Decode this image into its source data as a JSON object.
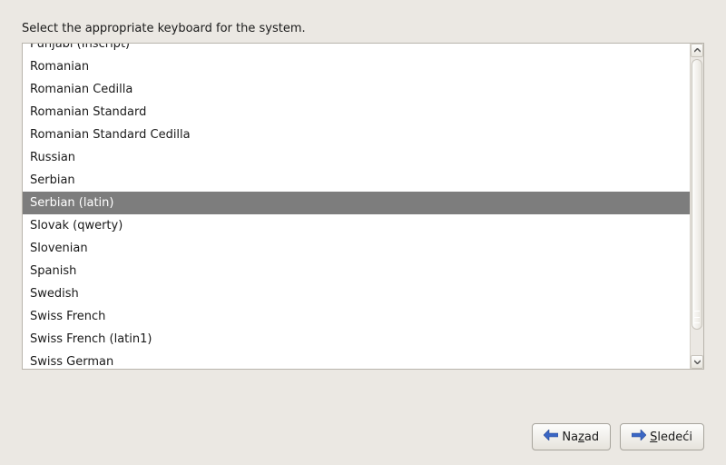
{
  "prompt": "Select the appropriate keyboard for the system.",
  "keyboard_list": {
    "selected_index": 7,
    "items": [
      "Punjabi (Inscript)",
      "Romanian",
      "Romanian Cedilla",
      "Romanian Standard",
      "Romanian Standard Cedilla",
      "Russian",
      "Serbian",
      "Serbian (latin)",
      "Slovak (qwerty)",
      "Slovenian",
      "Spanish",
      "Swedish",
      "Swiss French",
      "Swiss French (latin1)",
      "Swiss German"
    ]
  },
  "buttons": {
    "back": {
      "pre": "Na",
      "accel": "z",
      "post": "ad"
    },
    "next": {
      "pre": "",
      "accel": "S",
      "post": "ledeći"
    }
  },
  "icons": {
    "arrow_left": "arrow-left-icon",
    "arrow_right": "arrow-right-icon",
    "scroll_up": "chevron-up-icon",
    "scroll_down": "chevron-down-icon"
  }
}
